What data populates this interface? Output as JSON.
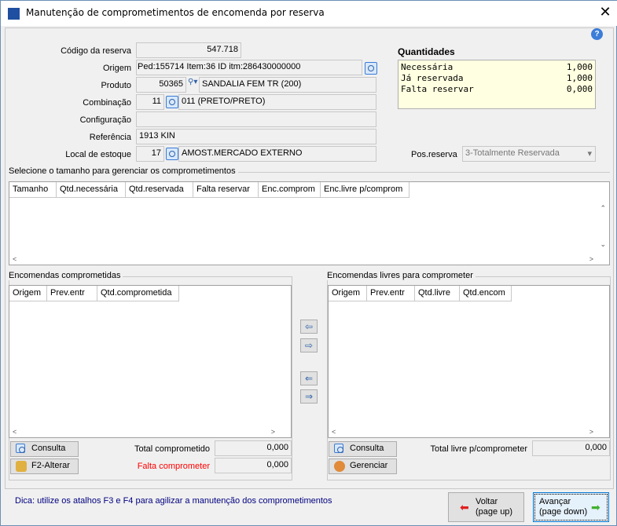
{
  "window": {
    "title": "Manutenção de comprometimentos de encomenda por reserva",
    "close": "✕",
    "help": "?"
  },
  "form": {
    "codigo_label": "Código da reserva",
    "codigo": "547.718",
    "origem_label": "Origem",
    "origem": "Ped:155714 Item:36 ID itm:286430000000",
    "produto_label": "Produto",
    "produto_code": "50365",
    "produto_desc": "SANDALIA FEM TR (200)",
    "combinacao_label": "Combinação",
    "combinacao_code": "11",
    "combinacao_desc": "011 (PRETO/PRETO)",
    "configuracao_label": "Configuração",
    "configuracao": "",
    "referencia_label": "Referência",
    "referencia": "1913 KIN",
    "local_label": "Local de estoque",
    "local_code": "17",
    "local_desc": "AMOST.MERCADO EXTERNO",
    "pos_label": "Pos.reserva",
    "pos_value": "3-Totalmente Reservada"
  },
  "quantidades": {
    "title": "Quantidades",
    "rows": [
      {
        "label": "Necessária",
        "value": "1,000"
      },
      {
        "label": "Já reservada",
        "value": "1,000"
      },
      {
        "label": "Falta reservar",
        "value": "0,000"
      }
    ]
  },
  "tamanho": {
    "title": "Selecione o tamanho para gerenciar os comprometimentos",
    "columns": [
      "Tamanho",
      "Qtd.necessária",
      "Qtd.reservada",
      "Falta reservar",
      "Enc.comprom",
      "Enc.livre p/comprom"
    ]
  },
  "comprometidas": {
    "title": "Encomendas comprometidas",
    "columns": [
      "Origem",
      "Prev.entr",
      "Qtd.comprometida"
    ],
    "consulta": "Consulta",
    "alterar": "F2-Alterar",
    "total_label": "Total comprometido",
    "total": "0,000",
    "falta_label": "Falta comprometer",
    "falta": "0,000"
  },
  "livres": {
    "title": "Encomendas livres para comprometer",
    "columns": [
      "Origem",
      "Prev.entr",
      "Qtd.livre",
      "Qtd.encom"
    ],
    "consulta": "Consulta",
    "gerenciar": "Gerenciar",
    "total_label": "Total livre p/comprometer",
    "total": "0,000"
  },
  "footer": {
    "dica": "Dica: utilize os atalhos F3 e F4 para agilizar a manutenção dos comprometimentos",
    "voltar": "Voltar",
    "voltar_sub": "(page up)",
    "avancar": "Avançar",
    "avancar_sub": "(page down)"
  },
  "colors": {
    "falta": "#ff0000",
    "dica": "#000080",
    "quant_bg": "#ffffe1"
  }
}
